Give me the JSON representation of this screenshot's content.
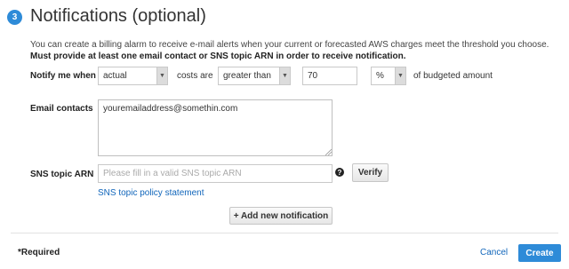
{
  "section": {
    "step": "3",
    "title": "Notifications (optional)",
    "description_plain": "You can create a billing alarm to receive e-mail alerts when your current or forecasted AWS charges meet the threshold you choose. ",
    "description_bold": "Must provide at least one email contact or SNS topic ARN in order to receive notification."
  },
  "notify": {
    "label": "Notify me when",
    "charge_type": "actual",
    "costs_are_label": "costs are",
    "comparison": "greater than",
    "threshold": "70",
    "unit": "%",
    "suffix": "of budgeted amount"
  },
  "email": {
    "label": "Email contacts",
    "value": "youremailaddress@somethin.com"
  },
  "sns": {
    "label": "SNS topic ARN",
    "placeholder": "Please fill in a valid SNS topic ARN",
    "help_glyph": "?",
    "verify_label": "Verify",
    "policy_link": "SNS topic policy statement"
  },
  "add_notification_label": "+ Add new notification",
  "footer": {
    "required_note": "*Required",
    "cancel_label": "Cancel",
    "create_label": "Create"
  },
  "colors": {
    "accent": "#2e8bd8",
    "link": "#1166bb"
  }
}
